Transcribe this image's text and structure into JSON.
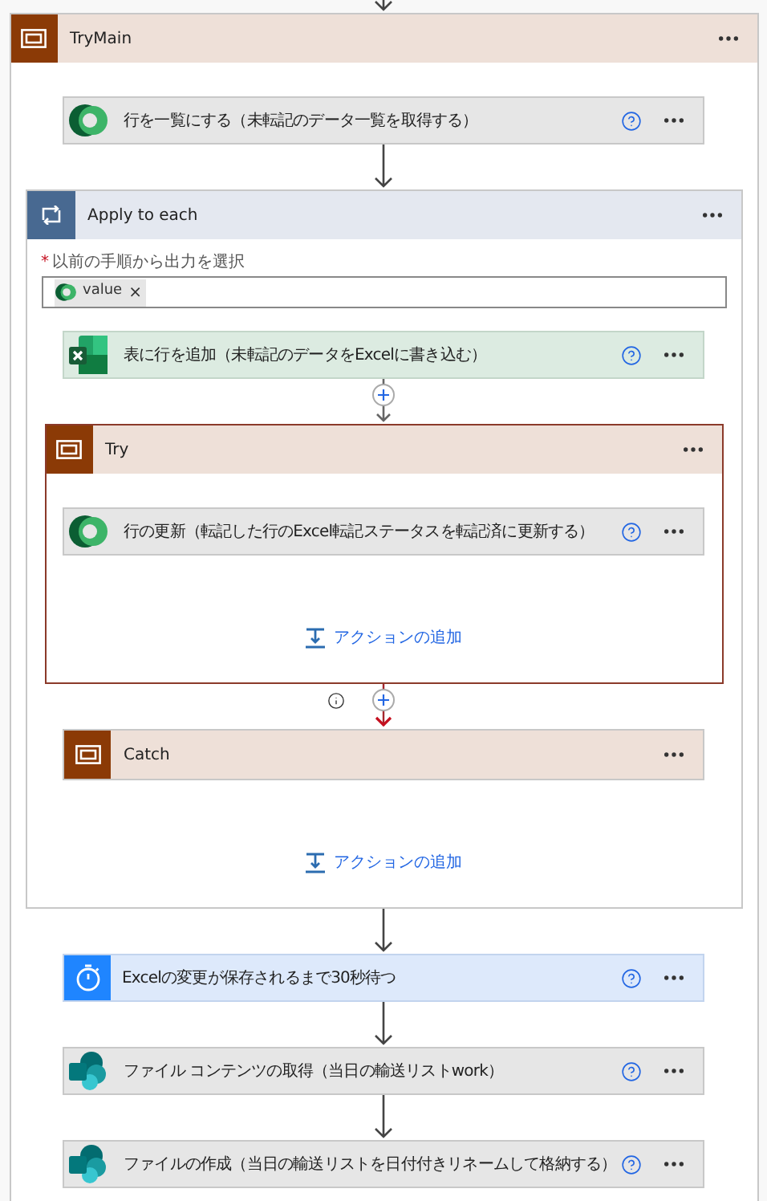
{
  "top_link": {
    "kind": "arrow"
  },
  "flow": {
    "kind": "scope",
    "title": "TryMain",
    "expanded": true,
    "selected": false,
    "steps": [
      {
        "kind": "dataverse",
        "title": "行を一覧にする（未転記のデータ一覧を取得する）"
      },
      {
        "kind": "foreach",
        "link": {
          "kind": "arrow"
        },
        "title": "Apply to each",
        "field": {
          "label": "以前の手順から出力を選択",
          "required_mark": "*",
          "token": {
            "kind": "dataverse",
            "text": "value",
            "remove": "×"
          }
        },
        "add_action": "アクションの追加",
        "steps": [
          {
            "kind": "excel",
            "title": "表に行を追加（未転記のデータをExcelに書き込む）"
          },
          {
            "kind": "scope",
            "link": {
              "kind": "plus"
            },
            "title": "Try",
            "expanded": true,
            "selected": true,
            "add_action": "アクションの追加",
            "steps": [
              {
                "kind": "dataverse",
                "title": "行の更新（転記した行のExcel転記ステータスを転記済に更新する）"
              }
            ]
          },
          {
            "kind": "scope",
            "link": {
              "kind": "failed"
            },
            "title": "Catch",
            "expanded": false,
            "selected": false
          }
        ]
      },
      {
        "kind": "delay",
        "link": {
          "kind": "arrow"
        },
        "title": "Excelの変更が保存されるまで30秒待つ"
      },
      {
        "kind": "sharepoint",
        "link": {
          "kind": "arrow"
        },
        "title": "ファイル コンテンツの取得（当日の輸送リストwork）"
      },
      {
        "kind": "sharepoint",
        "link": {
          "kind": "arrow"
        },
        "title": "ファイルの作成（当日の輸送リストを日付付きリネームして格納する）"
      }
    ]
  }
}
